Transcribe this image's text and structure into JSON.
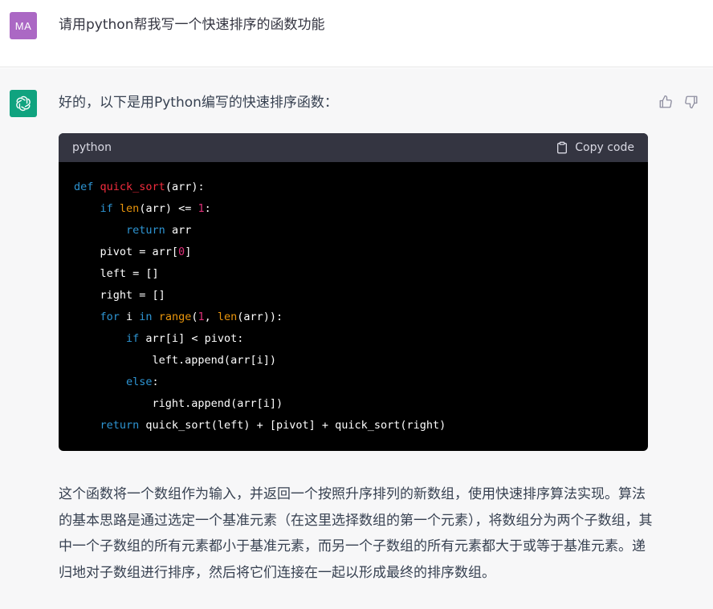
{
  "user": {
    "avatar_initials": "MA",
    "avatar_color": "#ab68c4",
    "message": "请用python帮我写一个快速排序的函数功能"
  },
  "assistant": {
    "avatar_icon": "openai-logo-icon",
    "avatar_color": "#10a37f",
    "intro": "好的，以下是用Python编写的快速排序函数：",
    "feedback": {
      "thumb_up_icon": "thumbs-up-icon",
      "thumb_down_icon": "thumbs-down-icon"
    },
    "code": {
      "language": "python",
      "copy_label": "Copy code",
      "lines": [
        [
          {
            "t": "def",
            "c": "kw"
          },
          {
            "t": " "
          },
          {
            "t": "quick_sort",
            "c": "fn"
          },
          {
            "t": "(arr):"
          }
        ],
        [
          {
            "t": "    "
          },
          {
            "t": "if",
            "c": "kw"
          },
          {
            "t": " "
          },
          {
            "t": "len",
            "c": "bi"
          },
          {
            "t": "(arr) <= "
          },
          {
            "t": "1",
            "c": "num"
          },
          {
            "t": ":"
          }
        ],
        [
          {
            "t": "        "
          },
          {
            "t": "return",
            "c": "kw"
          },
          {
            "t": " arr"
          }
        ],
        [
          {
            "t": "    pivot = arr["
          },
          {
            "t": "0",
            "c": "num"
          },
          {
            "t": "]"
          }
        ],
        [
          {
            "t": "    left = []"
          }
        ],
        [
          {
            "t": "    right = []"
          }
        ],
        [
          {
            "t": "    "
          },
          {
            "t": "for",
            "c": "kw"
          },
          {
            "t": " i "
          },
          {
            "t": "in",
            "c": "kw"
          },
          {
            "t": " "
          },
          {
            "t": "range",
            "c": "bi"
          },
          {
            "t": "("
          },
          {
            "t": "1",
            "c": "num"
          },
          {
            "t": ", "
          },
          {
            "t": "len",
            "c": "bi"
          },
          {
            "t": "(arr)):"
          }
        ],
        [
          {
            "t": "        "
          },
          {
            "t": "if",
            "c": "kw"
          },
          {
            "t": " arr[i] < pivot:"
          }
        ],
        [
          {
            "t": "            left.append(arr[i])"
          }
        ],
        [
          {
            "t": "        "
          },
          {
            "t": "else",
            "c": "kw"
          },
          {
            "t": ":"
          }
        ],
        [
          {
            "t": "            right.append(arr[i])"
          }
        ],
        [
          {
            "t": "    "
          },
          {
            "t": "return",
            "c": "kw"
          },
          {
            "t": " quick_sort(left) + [pivot] + quick_sort(right)"
          }
        ]
      ]
    },
    "explanation": "这个函数将一个数组作为输入，并返回一个按照升序排列的新数组，使用快速排序算法实现。算法的基本思路是通过选定一个基准元素（在这里选择数组的第一个元素），将数组分为两个子数组，其中一个子数组的所有元素都小于基准元素，而另一个子数组的所有元素都大于或等于基准元素。递归地对子数组进行排序，然后将它们连接在一起以形成最终的排序数组。"
  },
  "colors": {
    "code_header_bg": "#343541",
    "code_bg": "#000000",
    "keyword": "#2e95d3",
    "function_name": "#f22c3d",
    "builtin": "#e9950c",
    "number": "#df3079"
  }
}
